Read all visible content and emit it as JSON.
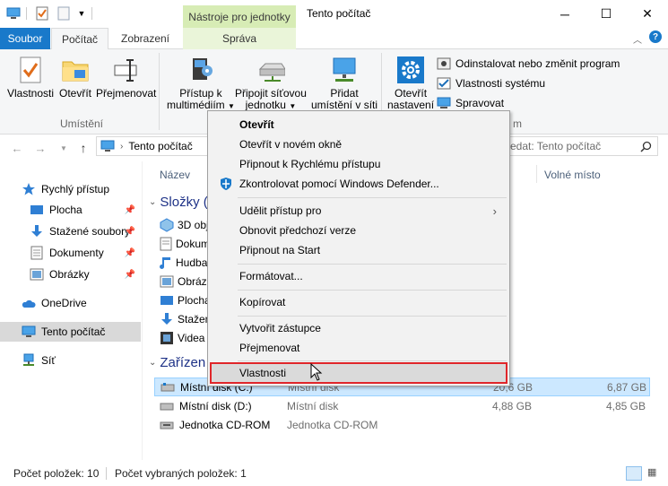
{
  "window": {
    "title": "Tento počítač",
    "contextual_tab_group": "Nástroje pro jednotky",
    "minimize": "─",
    "maximize": "☐",
    "close": "✕"
  },
  "tabs": {
    "file": "Soubor",
    "computer": "Počítač",
    "view": "Zobrazení",
    "manage": "Správa"
  },
  "ribbon": {
    "location_group": "Umístění",
    "properties": "Vlastnosti",
    "open": "Otevřít",
    "rename": "Přejmenovat",
    "media_access_l1": "Přístup k",
    "media_access_l2": "multimédiím",
    "map_drive_l1": "Připojit síťovou",
    "map_drive_l2": "jednotku",
    "add_location_l1": "Přidat",
    "add_location_l2": "umístění v síti",
    "open_settings_l1": "Otevřít",
    "open_settings_l2": "nastavení",
    "uninstall": "Odinstalovat nebo změnit program",
    "system_properties": "Vlastnosti systému",
    "manage": "Spravovat",
    "system_group_suffix": "m"
  },
  "address": {
    "path": "Tento počítač",
    "search_placeholder": "edat: Tento počítač"
  },
  "nav": {
    "quick_access": "Rychlý přístup",
    "desktop": "Plocha",
    "downloads": "Stažené soubory",
    "documents": "Dokumenty",
    "pictures": "Obrázky",
    "onedrive": "OneDrive",
    "this_pc": "Tento počítač",
    "network": "Síť"
  },
  "content": {
    "col_name": "Název",
    "col_free": "Volné místo",
    "folders_header": "Složky (",
    "devices_header": "Zařízen",
    "folders": [
      "3D obj",
      "Dokum",
      "Hudba",
      "Obráz",
      "Plocha",
      "Stažen",
      "Videa"
    ],
    "drives": [
      {
        "name": "Místní disk (C:)",
        "type": "Místní disk",
        "size": "20,6 GB",
        "free": "6,87 GB"
      },
      {
        "name": "Místní disk (D:)",
        "type": "Místní disk",
        "size": "4,88 GB",
        "free": "4,85 GB"
      },
      {
        "name": "Jednotka CD-ROM",
        "type": "Jednotka CD-ROM",
        "size": "",
        "free": ""
      }
    ]
  },
  "status": {
    "items": "Počet položek: 10",
    "selected": "Počet vybraných položek: 1"
  },
  "context_menu": {
    "open": "Otevřít",
    "open_new_window": "Otevřít v novém okně",
    "pin_quick": "Připnout k Rychlému přístupu",
    "defender": "Zkontrolovat pomocí Windows Defender...",
    "grant_access": "Udělit přístup pro",
    "restore_previous": "Obnovit předchozí verze",
    "pin_start": "Připnout na Start",
    "format": "Formátovat...",
    "copy": "Kopírovat",
    "create_shortcut": "Vytvořit zástupce",
    "rename": "Přejmenovat",
    "properties": "Vlastnosti"
  },
  "colors": {
    "accent": "#1979ca",
    "highlight_border": "#e0262a",
    "selection": "#cce8ff",
    "contextual_tab": "#d7ecb5"
  }
}
